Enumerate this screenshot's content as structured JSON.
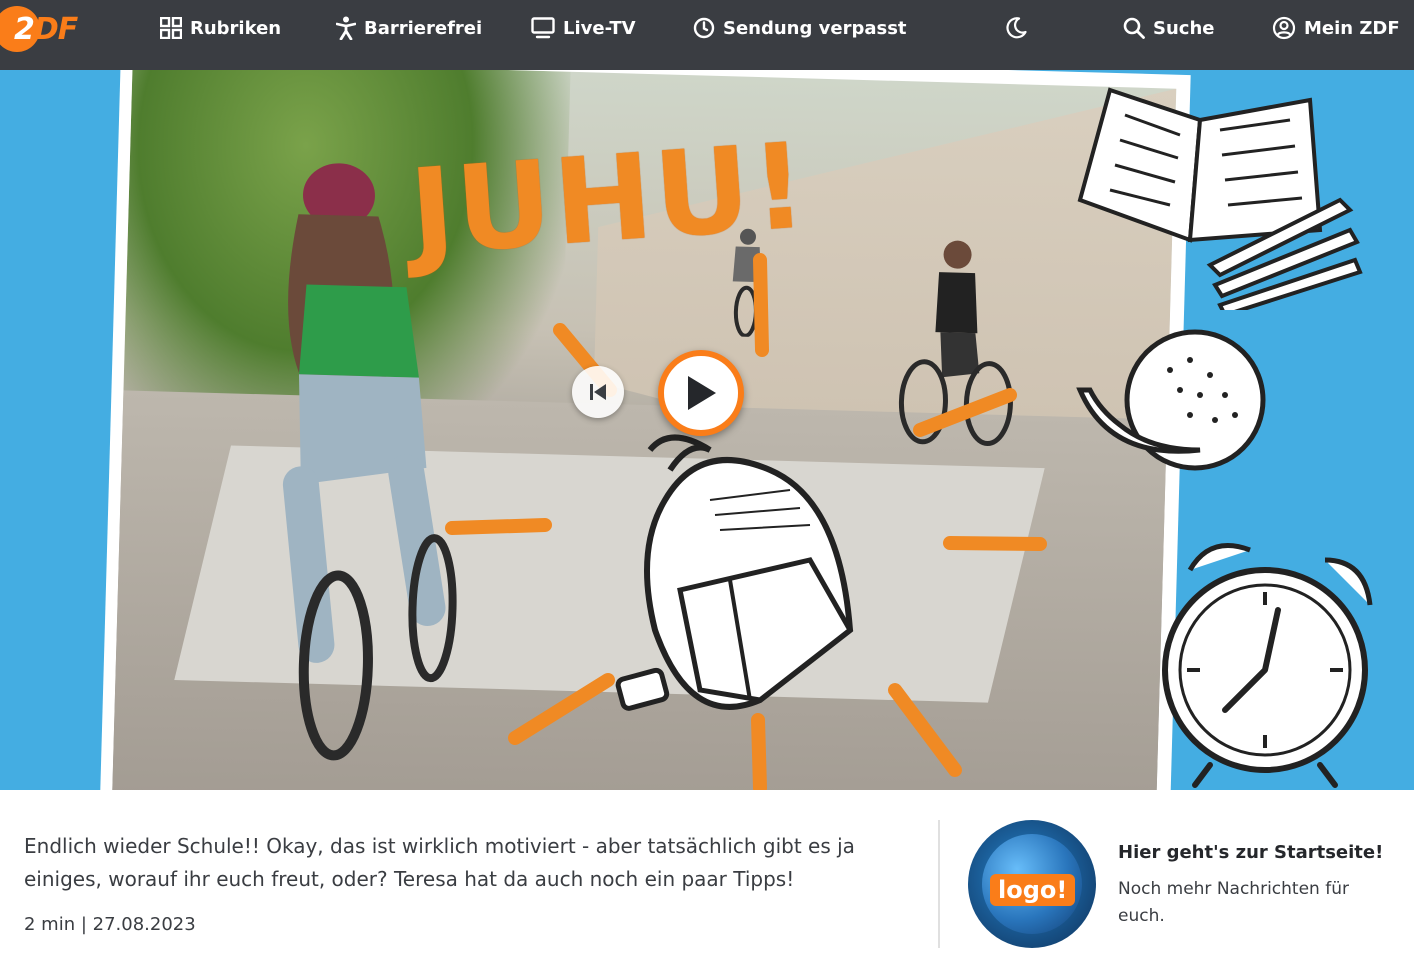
{
  "brand": {
    "logo_text": "ZDF"
  },
  "nav": {
    "rubriken": "Rubriken",
    "barrierefrei": "Barrierefrei",
    "live_tv": "Live-TV",
    "sendung_verpasst": "Sendung verpasst",
    "suche": "Suche",
    "mein_zdf": "Mein ZDF"
  },
  "hero": {
    "overlay_text": "JUHU!"
  },
  "video": {
    "description": "Endlich wieder Schule!! Okay, das ist wirklich motiviert - aber tatsächlich gibt es ja einiges, worauf ihr euch freut, oder? Teresa hat da auch noch ein paar Tipps!",
    "meta": "2 min | 27.08.2023"
  },
  "teaser": {
    "badge": "logo!",
    "title": "Hier geht's zur Startseite!",
    "subtitle": "Noch mehr Nachrichten für euch."
  },
  "colors": {
    "nav_bg": "#3a3d42",
    "accent": "#fa7d19",
    "hero_bg": "#44ade2"
  }
}
